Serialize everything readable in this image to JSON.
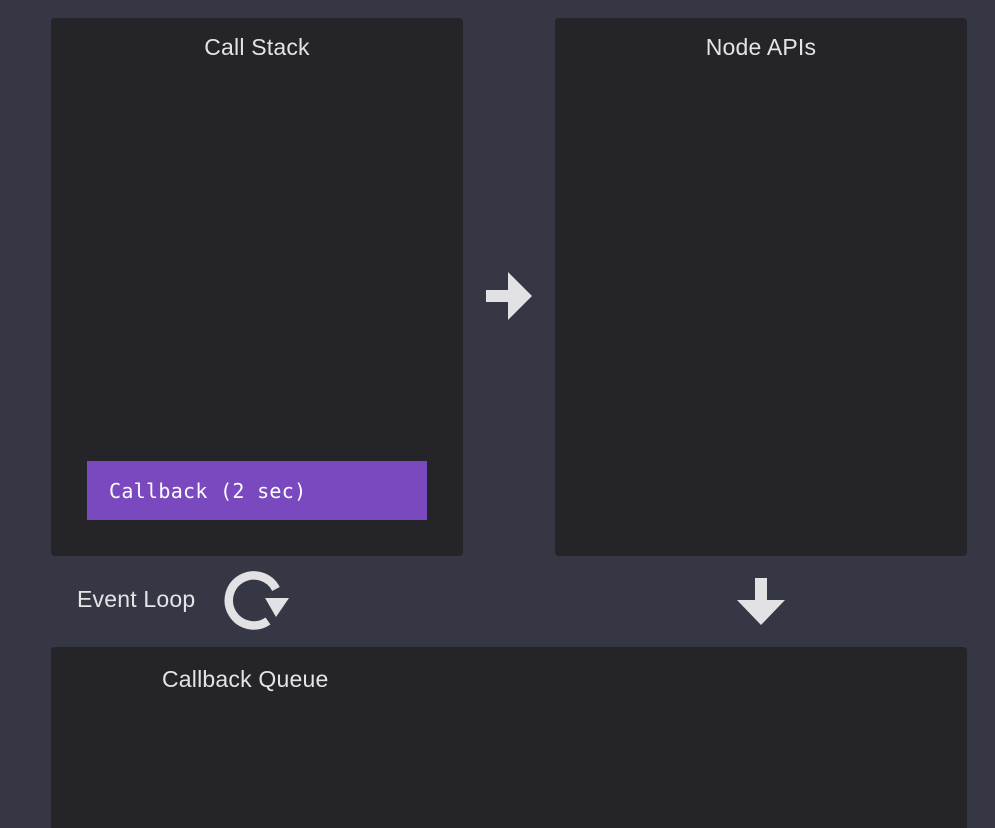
{
  "panels": {
    "call_stack": {
      "title": "Call Stack",
      "frames": [
        "Callback (2 sec)"
      ]
    },
    "node_apis": {
      "title": "Node APIs"
    },
    "callback_queue": {
      "title": "Callback Queue"
    }
  },
  "event_loop": {
    "label": "Event Loop",
    "icon": "refresh-loop-icon"
  },
  "arrows": {
    "stack_to_apis": "arrow-right-icon",
    "apis_to_queue": "arrow-down-icon"
  },
  "colors": {
    "background": "#353744",
    "panel": "#242429",
    "frame": "#7a49bf",
    "text": "#e4e4e6",
    "arrow": "#e2e2e4"
  }
}
